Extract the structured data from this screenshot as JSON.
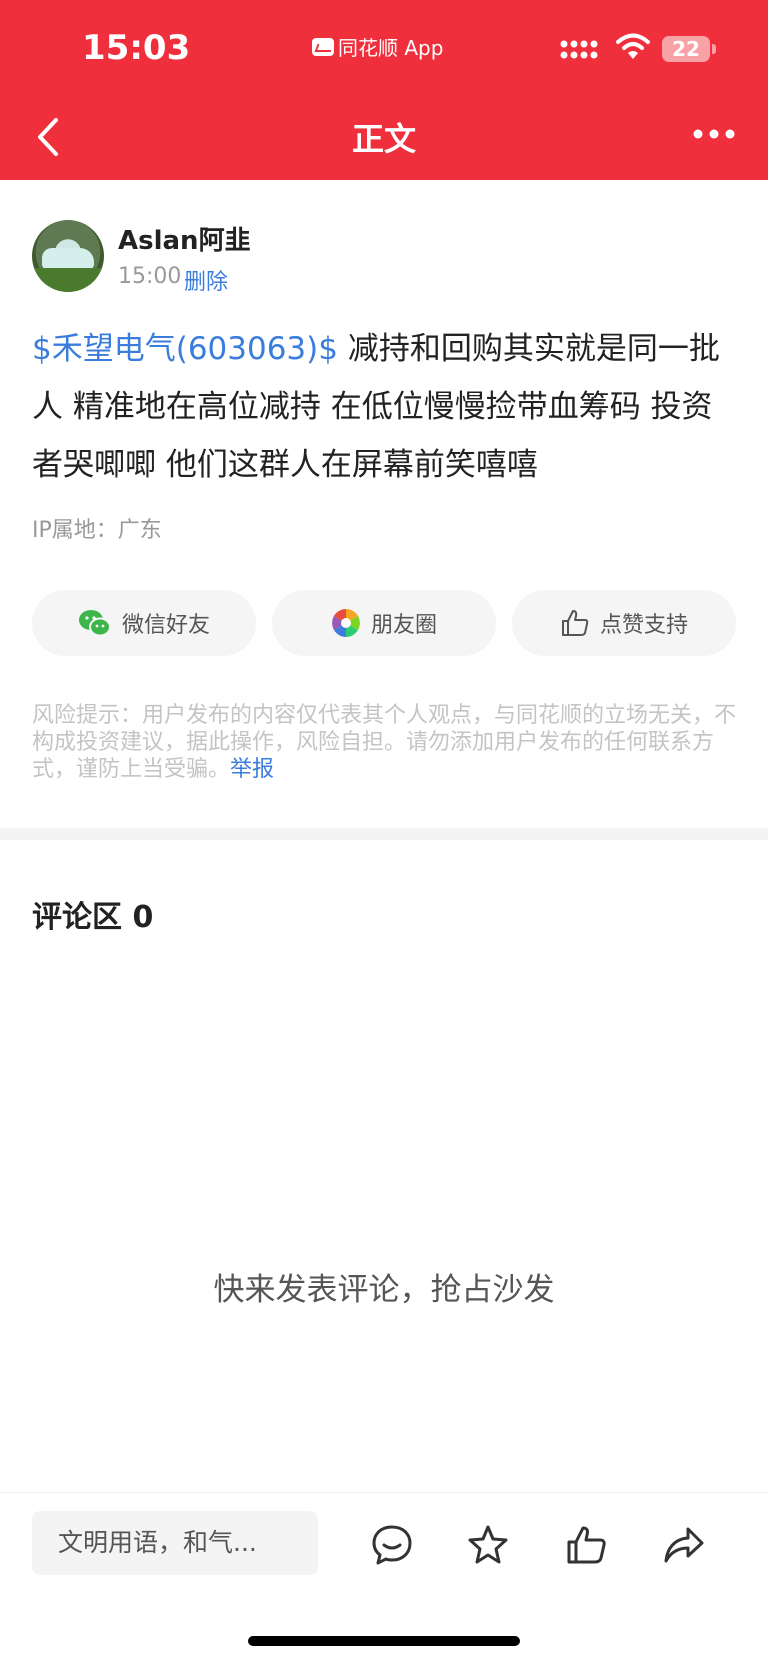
{
  "status_bar": {
    "time": "15:03",
    "app_label": "同花顺 App",
    "battery": "22"
  },
  "nav": {
    "title": "正文"
  },
  "post": {
    "author": "Aslan阿韭",
    "time": "15:00",
    "delete_label": "删除",
    "stock_tag": "$禾望电气(603063)$",
    "text": " 减持和回购其实就是同一批人 精准地在高位减持 在低位慢慢捡带血筹码 投资者哭唧唧 他们这群人在屏幕前笑嘻嘻",
    "ip_location": "IP属地：广东"
  },
  "share": {
    "wechat_label": "微信好友",
    "moments_label": "朋友圈",
    "like_label": "点赞支持"
  },
  "risk": {
    "text": "风险提示：用户发布的内容仅代表其个人观点，与同花顺的立场无关，不构成投资建议，据此操作，风险自担。请勿添加用户发布的任何联系方式，谨防上当受骗。",
    "report_label": "举报"
  },
  "comments": {
    "title": "评论区 0",
    "empty_text": "快来发表评论，抢占沙发"
  },
  "bottom_bar": {
    "input_placeholder": "文明用语，和气..."
  },
  "colors": {
    "brand_red": "#ef2f3b",
    "link_blue": "#3b7ddd"
  }
}
